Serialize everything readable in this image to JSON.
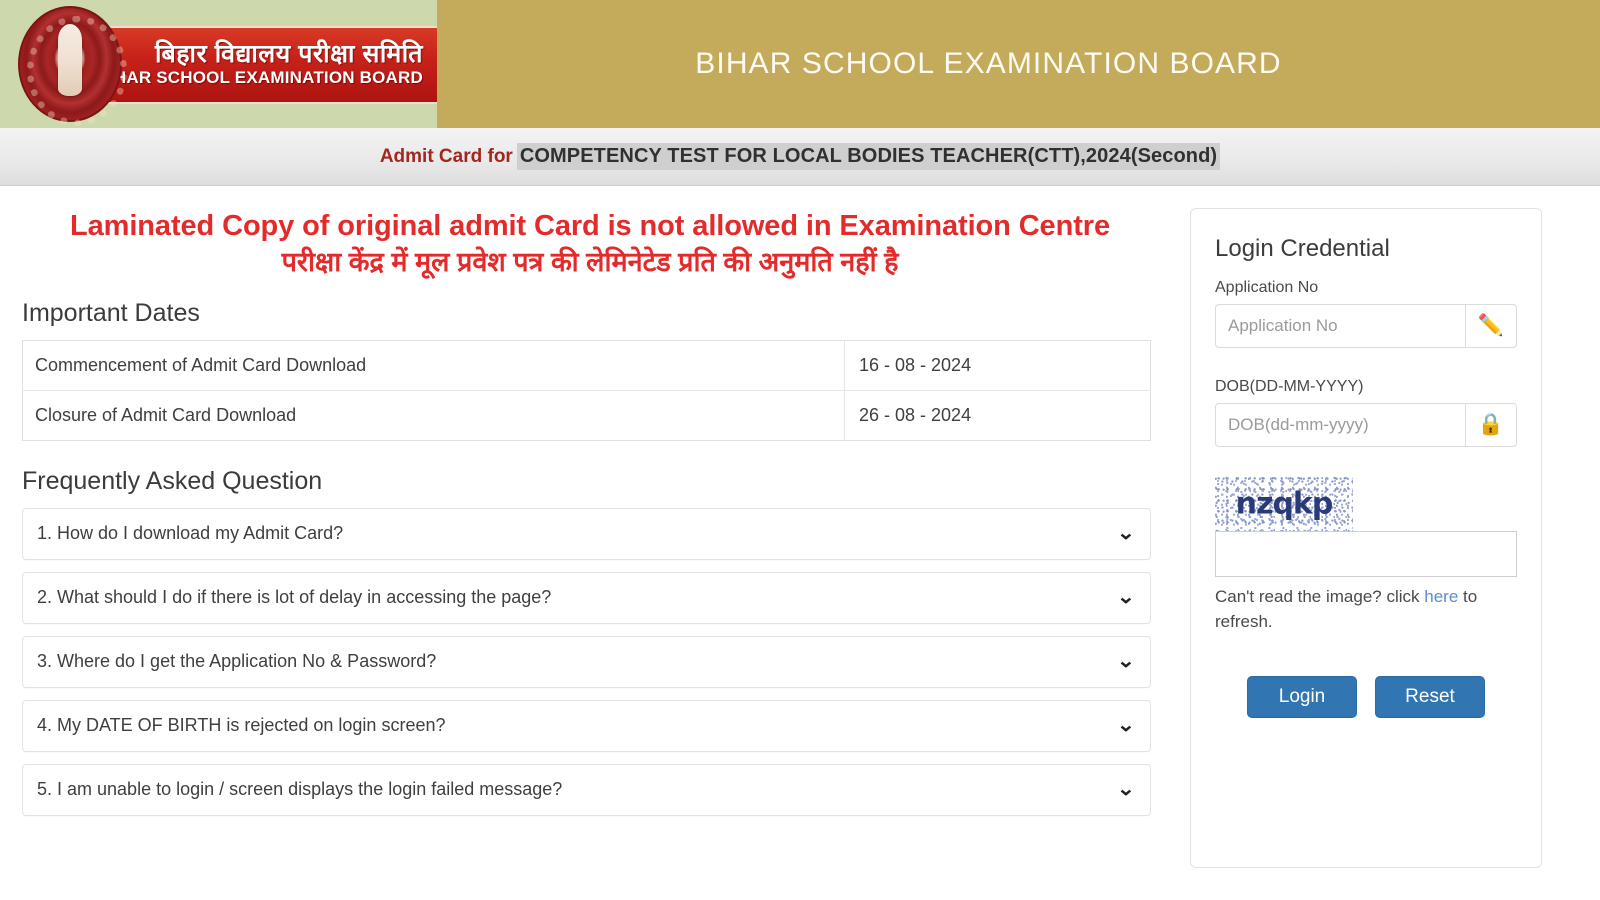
{
  "header": {
    "logo_hindi": "बिहार विद्यालय परीक्षा समिति",
    "logo_english": "BIHAR SCHOOL EXAMINATION BOARD",
    "board_title": "BIHAR SCHOOL EXAMINATION BOARD",
    "colors": {
      "banner_gold": "#c4ab5c",
      "logo_bg_green": "#cdd8ac",
      "ribbon_red": "#c7221a"
    }
  },
  "subtitle": {
    "prefix": "Admit Card for",
    "exam_name": "COMPETENCY TEST FOR LOCAL BODIES TEACHER(CTT),2024(Second)"
  },
  "notice": {
    "line_en": "Laminated Copy of original admit Card is not allowed in Examination Centre",
    "line_hi": "परीक्षा केंद्र में मूल प्रवेश पत्र की लेमिनेटेड प्रति की अनुमति नहीं है",
    "color": "#e32b2b"
  },
  "important_dates": {
    "title": "Important Dates",
    "rows": [
      {
        "label": "Commencement of Admit Card Download",
        "value": "16 - 08 - 2024"
      },
      {
        "label": "Closure of Admit Card Download",
        "value": "26 - 08 - 2024"
      }
    ]
  },
  "faq": {
    "title": "Frequently Asked Question",
    "chevron_icon": "⌄",
    "items": [
      {
        "question": "1. How do I download my Admit Card?"
      },
      {
        "question": "2. What should I do if there is lot of delay in accessing the page?"
      },
      {
        "question": "3. Where do I get the Application No & Password?"
      },
      {
        "question": "4. My DATE OF BIRTH is rejected on login screen?"
      },
      {
        "question": "5. I am unable to login / screen displays the login failed message?"
      }
    ]
  },
  "login": {
    "title": "Login Credential",
    "application_no": {
      "label": "Application No",
      "placeholder": "Application No",
      "value": "",
      "addon_icon": "✏️"
    },
    "dob": {
      "label": "DOB(DD-MM-YYYY)",
      "placeholder": "DOB(dd-mm-yyyy)",
      "value": "",
      "addon_icon": "🔒"
    },
    "captcha": {
      "text": "nzqkp",
      "input_value": "",
      "input_placeholder": "",
      "refresh_prefix": "Can't read the image? click ",
      "refresh_link": "here",
      "refresh_suffix": " to refresh."
    },
    "buttons": {
      "login": "Login",
      "reset": "Reset",
      "color": "#3176b2"
    }
  }
}
